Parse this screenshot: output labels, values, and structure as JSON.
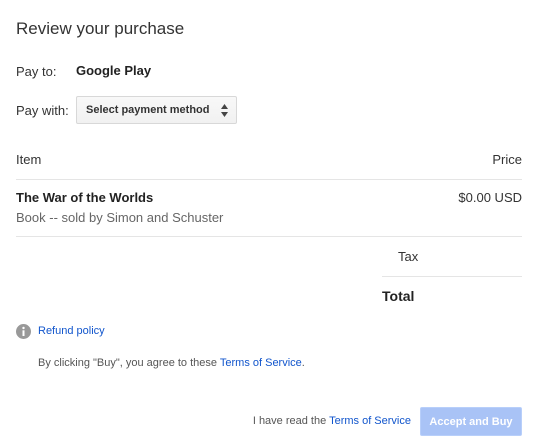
{
  "header": {
    "title": "Review your purchase"
  },
  "pay_to": {
    "label": "Pay to:",
    "value": "Google Play"
  },
  "pay_with": {
    "label": "Pay with:",
    "select_label": "Select payment method",
    "icon": "updown-arrows-icon"
  },
  "table": {
    "col_item": "Item",
    "col_price": "Price",
    "product": {
      "title": "The War of the Worlds",
      "subtitle": "Book -- sold by Simon and Schuster",
      "price": "$0.00 USD"
    },
    "tax_label": "Tax",
    "total_label": "Total"
  },
  "refund": {
    "icon": "info-icon",
    "link": "Refund policy"
  },
  "agreement": {
    "prefix": "By clicking \"Buy\", you agree to these ",
    "link": "Terms of Service",
    "suffix": "."
  },
  "footer": {
    "prefix": "I have read the ",
    "link": "Terms of Service",
    "button": "Accept and Buy"
  },
  "colors": {
    "link": "#1155cc",
    "button_disabled": "#a9c3f6"
  }
}
